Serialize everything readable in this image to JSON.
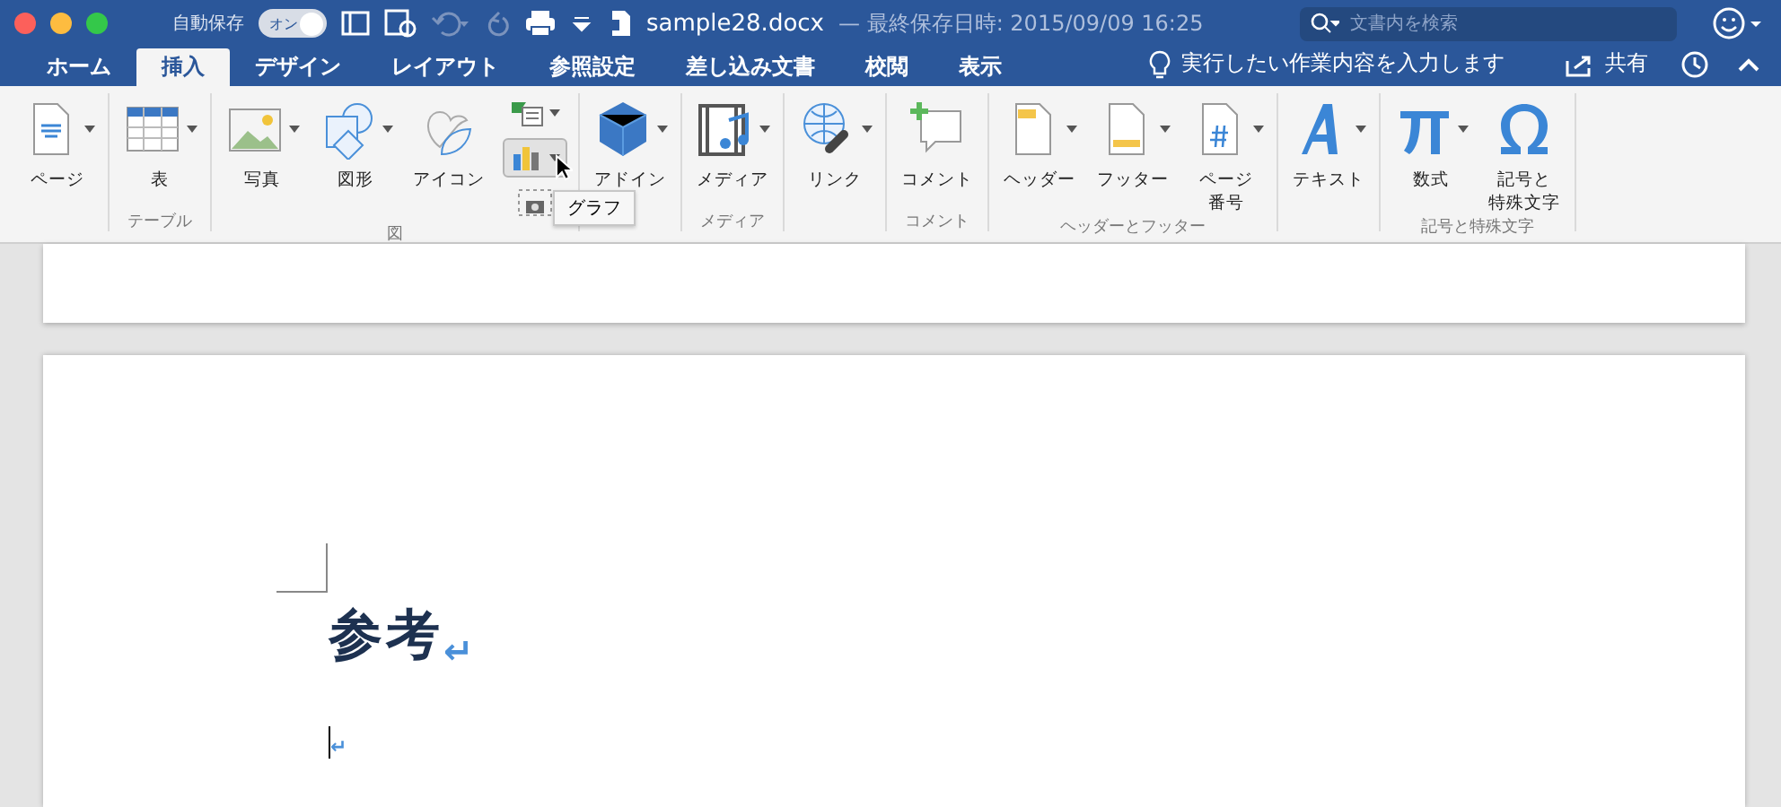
{
  "title_bar": {
    "autosave": {
      "label": "自動保存",
      "toggle_label": "オン",
      "on": true
    },
    "file_name": "sample28.docx",
    "saved": "— 最終保存日時: 2015/09/09 16:25",
    "search": {
      "placeholder": "文書内を検索"
    }
  },
  "tabs": [
    {
      "label": "ホーム",
      "selected": false
    },
    {
      "label": "挿入",
      "selected": true
    },
    {
      "label": "デザイン",
      "selected": false
    },
    {
      "label": "レイアウト",
      "selected": false
    },
    {
      "label": "参照設定",
      "selected": false
    },
    {
      "label": "差し込み文書",
      "selected": false
    },
    {
      "label": "校閲",
      "selected": false
    },
    {
      "label": "表示",
      "selected": false
    }
  ],
  "tell_me": "実行したい作業内容を入力します",
  "share": "共有",
  "ribbon": [
    {
      "buttons": [
        {
          "kind": "large",
          "label_lines": [
            "ページ"
          ],
          "dropdown": true
        }
      ]
    },
    {
      "label": "テーブル",
      "buttons": [
        {
          "kind": "large",
          "label_lines": [
            "表"
          ],
          "dropdown": true
        }
      ]
    },
    {
      "label": "図",
      "buttons": [
        {
          "kind": "large",
          "label_lines": [
            "写真"
          ],
          "dropdown": true
        },
        {
          "kind": "large",
          "label_lines": [
            "図形"
          ],
          "dropdown": true
        },
        {
          "kind": "large",
          "label_lines": [
            "アイコン"
          ],
          "dropdown": false
        },
        {
          "kind": "stack",
          "items": [
            {
              "selected": false
            },
            {
              "selected": true
            },
            {
              "selected": false
            }
          ]
        }
      ]
    },
    {
      "buttons": [
        {
          "kind": "large",
          "label_lines": [
            "アドイン"
          ],
          "dropdown": true
        }
      ]
    },
    {
      "label": "メディア",
      "buttons": [
        {
          "kind": "large",
          "label_lines": [
            "メディア"
          ],
          "dropdown": true
        }
      ]
    },
    {
      "buttons": [
        {
          "kind": "large",
          "label_lines": [
            "リンク"
          ],
          "dropdown": true
        }
      ]
    },
    {
      "label": "コメント",
      "buttons": [
        {
          "kind": "large",
          "label_lines": [
            "コメント"
          ],
          "dropdown": false
        }
      ]
    },
    {
      "label": "ヘッダーとフッター",
      "buttons": [
        {
          "kind": "large",
          "label_lines": [
            "ヘッダー"
          ],
          "dropdown": true
        },
        {
          "kind": "large",
          "label_lines": [
            "フッター"
          ],
          "dropdown": true
        },
        {
          "kind": "large",
          "label_lines": [
            "ページ",
            "番号"
          ],
          "dropdown": true
        }
      ]
    },
    {
      "buttons": [
        {
          "kind": "large",
          "label_lines": [
            "テキスト"
          ],
          "dropdown": true
        }
      ]
    },
    {
      "label": "記号と特殊文字",
      "buttons": [
        {
          "kind": "large",
          "label_lines": [
            "数式"
          ],
          "dropdown": true
        },
        {
          "kind": "large",
          "label_lines": [
            "記号と",
            "特殊文字"
          ],
          "dropdown": false
        }
      ]
    }
  ],
  "tooltip": "グラフ",
  "document": {
    "paragraphs": [
      {
        "kind": "heading",
        "text": "参考",
        "mark": "↵"
      },
      {
        "kind": "empty",
        "mark": "↵",
        "cursor": true
      }
    ]
  }
}
